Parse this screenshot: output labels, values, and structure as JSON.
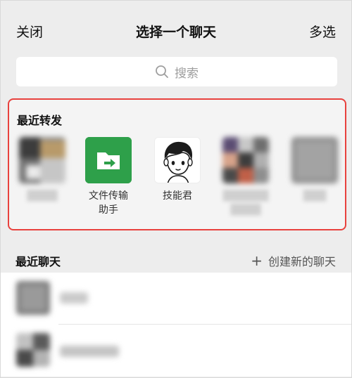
{
  "header": {
    "close_label": "关闭",
    "title": "选择一个聊天",
    "multi_select_label": "多选"
  },
  "search": {
    "placeholder": "搜索",
    "icon": "search-icon"
  },
  "recent_forward": {
    "title": "最近转发",
    "contacts": [
      {
        "label": "",
        "blurred": true
      },
      {
        "label": "文件传输\n助手",
        "icon": "folder-transfer-icon",
        "color": "#2ea04a"
      },
      {
        "label": "技能君",
        "icon": "cartoon-avatar"
      },
      {
        "label": "",
        "blurred": true
      },
      {
        "label": "",
        "blurred": true
      }
    ]
  },
  "recent_chats": {
    "title": "最近聊天",
    "create_label": "创建新的聊天",
    "create_icon": "plus-icon"
  },
  "colors": {
    "accent_red": "#e8413d",
    "file_transfer_green": "#2ea04a",
    "background": "#ededed"
  }
}
